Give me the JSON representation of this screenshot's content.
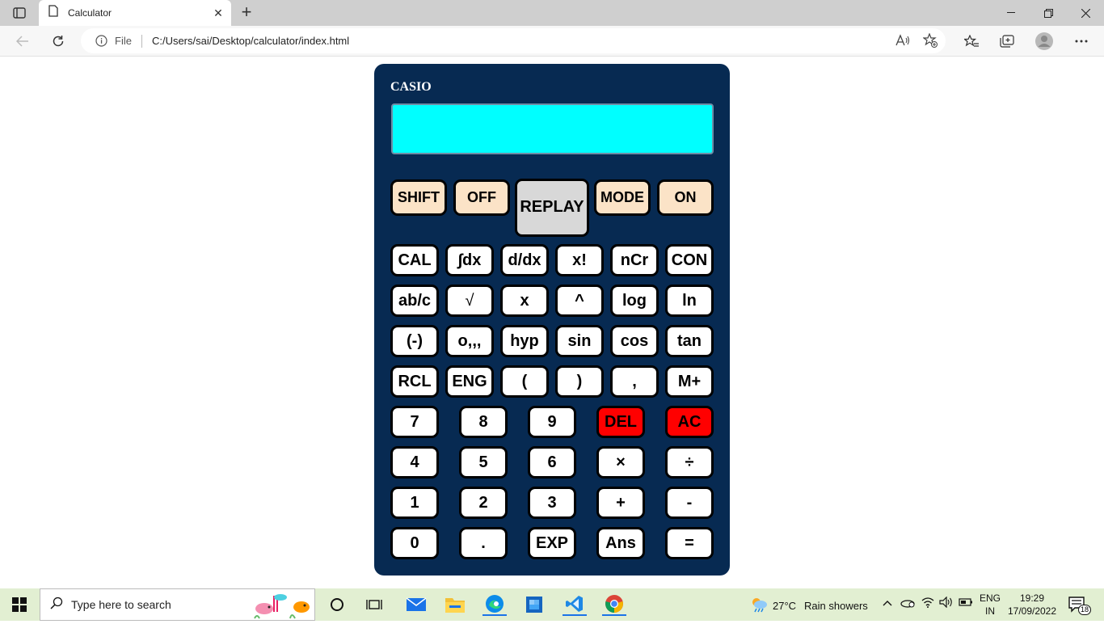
{
  "browser": {
    "tab_title": "Calculator",
    "tab_close": "✕",
    "new_tab": "+",
    "url_scheme_label": "File",
    "url": "C:/Users/sai/Desktop/calculator/index.html"
  },
  "calculator": {
    "brand": "CASIO",
    "display_value": "",
    "top_keys": [
      "SHIFT",
      "OFF",
      "REPLAY",
      "MODE",
      "ON"
    ],
    "sci_rows": [
      [
        "CAL",
        "∫dx",
        "d/dx",
        "x!",
        "nCr",
        "CON"
      ],
      [
        "ab/c",
        "√",
        "x",
        "^",
        "log",
        "ln"
      ],
      [
        "(-)",
        "o,,,",
        "hyp",
        "sin",
        "cos",
        "tan"
      ],
      [
        "RCL",
        "ENG",
        "(",
        ")",
        ",",
        "M+"
      ]
    ],
    "num_rows": [
      [
        "7",
        "8",
        "9",
        "DEL",
        "AC"
      ],
      [
        "4",
        "5",
        "6",
        "×",
        "÷"
      ],
      [
        "1",
        "2",
        "3",
        "+",
        "-"
      ],
      [
        "0",
        ".",
        "EXP",
        "Ans",
        "="
      ]
    ],
    "colors": {
      "body": "#072a52",
      "screen": "#00ffff",
      "top_key": "#fbe3c7",
      "replay_key": "#d8d8d8",
      "danger_key": "#ff0000"
    }
  },
  "taskbar": {
    "search_placeholder": "Type here to search",
    "weather_temp": "27°C",
    "weather_text": "Rain showers",
    "lang_line1": "ENG",
    "lang_line2": "IN",
    "time": "19:29",
    "date": "17/09/2022",
    "notification_count": "18"
  }
}
